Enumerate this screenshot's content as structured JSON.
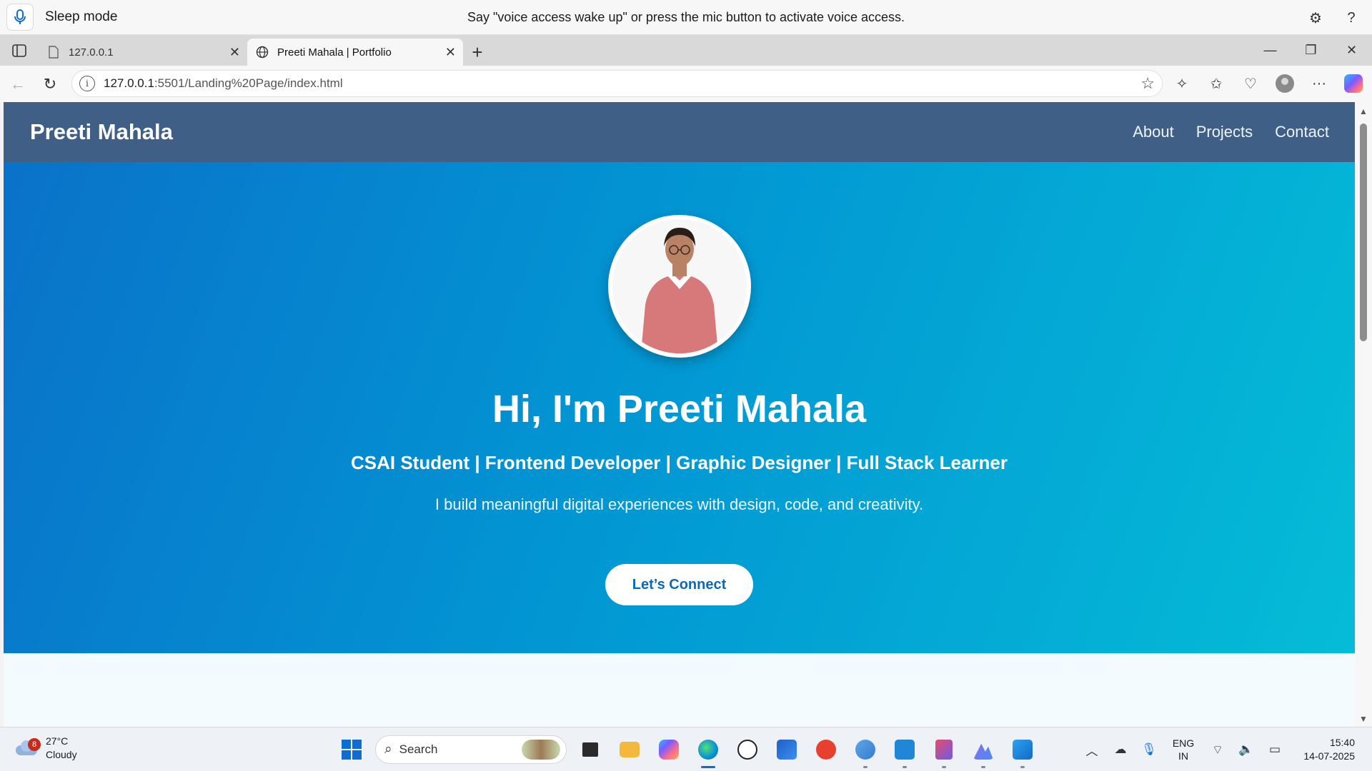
{
  "voice_access": {
    "status": "Sleep mode",
    "hint": "Say \"voice access wake up\" or press the mic button to activate voice access."
  },
  "tabs": [
    {
      "title": "127.0.0.1",
      "active": false
    },
    {
      "title": "Preeti Mahala | Portfolio",
      "active": true
    }
  ],
  "address_bar": {
    "url_host": "127.0.0.1",
    "url_rest": ":5501/Landing%20Page/index.html"
  },
  "site": {
    "brand": "Preeti Mahala",
    "nav": [
      "About",
      "Projects",
      "Contact"
    ],
    "hero": {
      "heading": "Hi, I'm Preeti Mahala",
      "tagline": "CSAI Student | Frontend Developer | Graphic Designer | Full Stack Learner",
      "description": "I build meaningful digital experiences with design, code, and creativity.",
      "cta": "Let’s Connect"
    },
    "colors": {
      "nav_bg": "#3f5f86",
      "hero_start": "#0a72c9",
      "hero_end": "#05bcd7",
      "cta_text": "#0a69b8"
    }
  },
  "taskbar": {
    "weather": {
      "badge": "8",
      "temp": "27°C",
      "condition": "Cloudy"
    },
    "search_placeholder": "Search",
    "apps": [
      "task-view",
      "file-explorer",
      "copilot",
      "edge",
      "dell",
      "store",
      "wps-office",
      "teams",
      "vs-code",
      "snipping-tool",
      "paint",
      "photos"
    ],
    "language": {
      "line1": "ENG",
      "line2": "IN"
    },
    "time": "15:40",
    "date": "14-07-2025"
  }
}
